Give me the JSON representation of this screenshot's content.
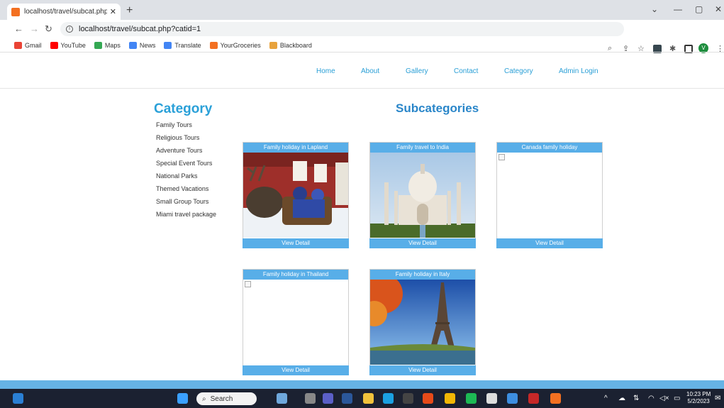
{
  "browser": {
    "tab_title": "localhost/travel/subcat.php?catid",
    "url": "localhost/travel/subcat.php?catid=1",
    "profile_initial": "V",
    "bookmarks": [
      "Gmail",
      "YouTube",
      "Maps",
      "News",
      "Translate",
      "YourGroceries",
      "Blackboard"
    ]
  },
  "nav": {
    "home": "Home",
    "about": "About",
    "gallery": "Gallery",
    "contact": "Contact",
    "category": "Category",
    "admin": "Admin Login"
  },
  "sidebar": {
    "title": "Category",
    "items": [
      "Family Tours",
      "Religious Tours",
      "Adventure Tours",
      "Special Event Tours",
      "National Parks",
      "Themed Vacations",
      "Small Group Tours",
      "Miami travel package"
    ]
  },
  "main": {
    "title": "Subcategories",
    "cards": [
      {
        "title": "Family holiday in Lapland",
        "button": "View Detail"
      },
      {
        "title": "Family travel to India",
        "button": "View Detail"
      },
      {
        "title": "Canada family holiday",
        "button": "View Detail"
      },
      {
        "title": "Family holiday in Thailand",
        "button": "View Detail"
      },
      {
        "title": "Family holiday in Italy",
        "button": "View Detail"
      }
    ]
  },
  "taskbar": {
    "search": "Search",
    "time": "10:23 PM",
    "date": "5/2/2023"
  },
  "colors": {
    "accent": "#2aa0d8",
    "card_band": "#58aee8",
    "footer": "#66b3e5",
    "taskbar": "#1b2131"
  }
}
